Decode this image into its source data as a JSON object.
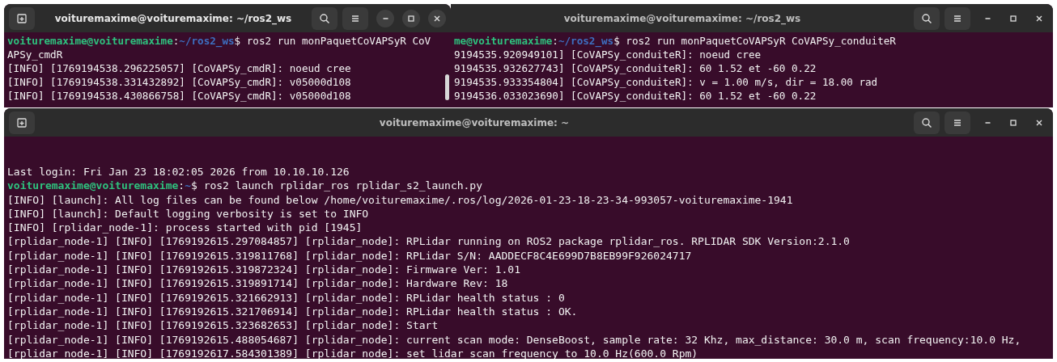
{
  "windows": [
    {
      "title": "voituremaxime@voituremaxime: ~/ros2_ws",
      "active": true,
      "new_tab": true,
      "scrollbar": true,
      "lines": [
        {
          "kind": "prompt",
          "user_host": "voituremaxime@voituremaxime",
          "separator": ":",
          "path": "~/ros2_ws",
          "command": "$ ros2 run monPaquetCoVAPSyR CoV"
        },
        {
          "kind": "output",
          "text": "APSy_cmdR"
        },
        {
          "kind": "output",
          "text": "[INFO] [1769194538.296225057] [CoVAPSy_cmdR]: noeud cree"
        },
        {
          "kind": "output",
          "text": "[INFO] [1769194538.331432892] [CoVAPSy_cmdR]: v05000d108"
        },
        {
          "kind": "output",
          "text": "[INFO] [1769194538.430866758] [CoVAPSy_cmdR]: v05000d108"
        }
      ]
    },
    {
      "title": "voituremaxime@voituremaxime: ~/ros2_ws",
      "active": false,
      "new_tab": false,
      "scrollbar": false,
      "lines": [
        {
          "kind": "prompt",
          "user_host": "me@voituremaxime",
          "separator": ":",
          "path": "~/ros2_ws",
          "command": "$ ros2 run monPaquetCoVAPSyR CoVAPSy_conduiteR"
        },
        {
          "kind": "output",
          "text": "9194535.920949101] [CoVAPSy_conduiteR]: noeud cree"
        },
        {
          "kind": "output",
          "text": "9194535.932627743] [CoVAPSy_conduiteR]: 60 1.52 et -60 0.22"
        },
        {
          "kind": "output",
          "text": "9194535.933354804] [CoVAPSy_conduiteR]: v = 1.00 m/s, dir = 18.00 rad"
        },
        {
          "kind": "output",
          "text": "9194536.033023690] [CoVAPSy_conduiteR]: 60 1.52 et -60 0.22"
        }
      ]
    },
    {
      "title": "voituremaxime@voituremaxime: ~",
      "active": false,
      "new_tab": true,
      "scrollbar": false,
      "lines": [
        {
          "kind": "output",
          "text": "Last login: Fri Jan 23 18:02:05 2026 from 10.10.10.126"
        },
        {
          "kind": "prompt",
          "user_host": "voituremaxime@voituremaxime",
          "separator": ":",
          "path": "~",
          "command": "$ ros2 launch rplidar_ros rplidar_s2_launch.py"
        },
        {
          "kind": "output",
          "text": "[INFO] [launch]: All log files can be found below /home/voituremaxime/.ros/log/2026-01-23-18-23-34-993057-voituremaxime-1941"
        },
        {
          "kind": "output",
          "text": "[INFO] [launch]: Default logging verbosity is set to INFO"
        },
        {
          "kind": "output",
          "text": "[INFO] [rplidar_node-1]: process started with pid [1945]"
        },
        {
          "kind": "output",
          "text": "[rplidar_node-1] [INFO] [1769192615.297084857] [rplidar_node]: RPLidar running on ROS2 package rplidar_ros. RPLIDAR SDK Version:2.1.0"
        },
        {
          "kind": "output",
          "text": "[rplidar_node-1] [INFO] [1769192615.319811768] [rplidar_node]: RPLidar S/N: AADDECF8C4E699D7B8EB99F926024717"
        },
        {
          "kind": "output",
          "text": "[rplidar_node-1] [INFO] [1769192615.319872324] [rplidar_node]: Firmware Ver: 1.01"
        },
        {
          "kind": "output",
          "text": "[rplidar_node-1] [INFO] [1769192615.319891714] [rplidar_node]: Hardware Rev: 18"
        },
        {
          "kind": "output",
          "text": "[rplidar_node-1] [INFO] [1769192615.321662913] [rplidar_node]: RPLidar health status : 0"
        },
        {
          "kind": "output",
          "text": "[rplidar_node-1] [INFO] [1769192615.321706914] [rplidar_node]: RPLidar health status : OK."
        },
        {
          "kind": "output",
          "text": "[rplidar_node-1] [INFO] [1769192615.323682653] [rplidar_node]: Start"
        },
        {
          "kind": "output",
          "text": "[rplidar_node-1] [INFO] [1769192615.488054687] [rplidar_node]: current scan mode: DenseBoost, sample rate: 32 Khz, max_distance: 30.0 m, scan frequency:10.0 Hz,"
        },
        {
          "kind": "output",
          "text": "[rplidar_node-1] [INFO] [1769192617.584301389] [rplidar_node]: set lidar scan frequency to 10.0 Hz(600.0 Rpm)"
        }
      ]
    }
  ]
}
